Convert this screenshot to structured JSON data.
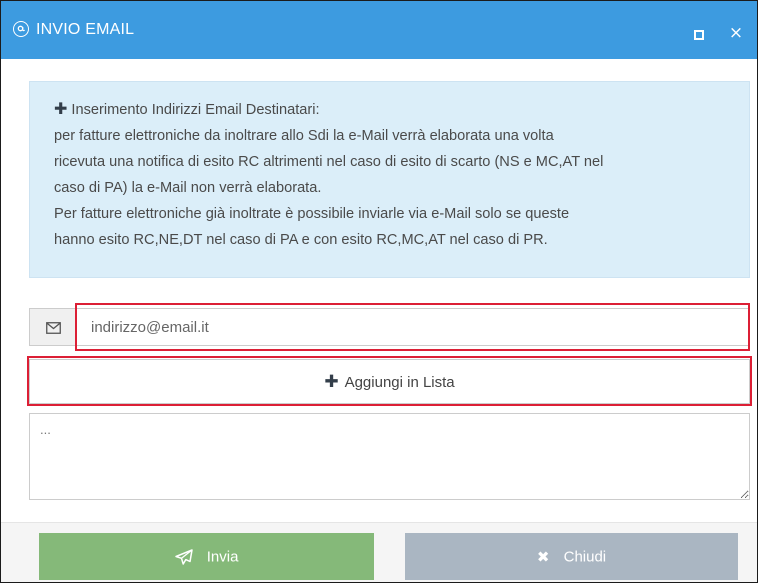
{
  "dialog": {
    "title": "INVIO EMAIL",
    "title_icon": "at-sign-icon",
    "maximize_icon": "maximize-icon",
    "close_icon": "close-icon",
    "close_glyph": "×"
  },
  "info": {
    "icon": "plus-icon",
    "plus_glyph": "✚",
    "lines": [
      "Inserimento Indirizzi Email Destinatari:",
      "per fatture elettroniche da inoltrare allo Sdi la e-Mail verrà elaborata una volta",
      "ricevuta una notifica di esito RC altrimenti nel caso di esito di scarto (NS e MC,AT nel",
      "caso di PA) la e-Mail non verrà elaborata.",
      "Per fatture elettroniche già inoltrate è possibile inviarle via e-Mail solo se queste",
      "hanno esito RC,NE,DT nel caso di PA e con esito RC,MC,AT nel caso di PR."
    ]
  },
  "email": {
    "icon": "envelope-icon",
    "placeholder": "indirizzo@email.it",
    "value": ""
  },
  "add_button": {
    "icon": "plus-icon",
    "plus_glyph": "✚",
    "label": "Aggiungi in Lista"
  },
  "notes": {
    "placeholder": "...",
    "value": ""
  },
  "footer": {
    "send_label": "Invia",
    "send_icon": "paper-plane-icon",
    "close_label": "Chiudi",
    "close_icon": "times-icon",
    "close_glyph": "✖"
  },
  "colors": {
    "titlebar": "#3d9be0",
    "info_bg": "#dbeef9",
    "highlight": "#dc1f35",
    "send_button": "#85b979",
    "close_button": "#aab6c2"
  }
}
